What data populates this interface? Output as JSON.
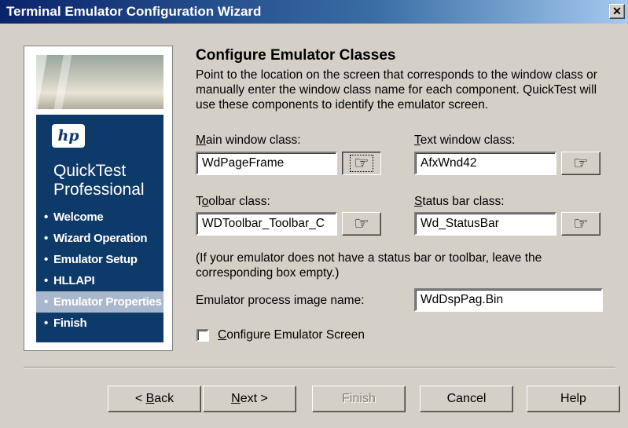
{
  "window": {
    "title": "Terminal Emulator Configuration Wizard",
    "close_glyph": "✕"
  },
  "sidebar": {
    "logo_text": "hp",
    "product_line1": "QuickTest",
    "product_line2": "Professional",
    "steps": [
      {
        "label": "Welcome"
      },
      {
        "label": "Wizard Operation"
      },
      {
        "label": "Emulator Setup"
      },
      {
        "label": "HLLAPI"
      },
      {
        "label": "Emulator Properties",
        "active": true
      },
      {
        "label": "Finish"
      }
    ]
  },
  "page": {
    "heading": "Configure Emulator Classes",
    "description": "Point to the location on the screen that corresponds to the window class or manually enter the window class name for each component. QuickTest will use these components to identify the emulator screen."
  },
  "fields": {
    "main_window": {
      "label_pre": "",
      "label_u": "M",
      "label_post": "ain window class:",
      "value": "WdPageFrame"
    },
    "text_window": {
      "label_pre": "",
      "label_u": "T",
      "label_post": "ext window class:",
      "value": "AfxWnd42"
    },
    "toolbar": {
      "label_pre": "T",
      "label_u": "o",
      "label_post": "olbar class:",
      "value": "WDToolbar_Toolbar_C"
    },
    "status_bar": {
      "label_pre": "",
      "label_u": "S",
      "label_post": "tatus bar class:",
      "value": "Wd_StatusBar"
    },
    "process_image": {
      "label": "Emulator process image name:",
      "value": "WdDspPag.Bin"
    }
  },
  "note": "(If your emulator does not have a status bar or toolbar, leave the corresponding box empty.)",
  "checkbox": {
    "label_u": "C",
    "label_post": "onfigure Emulator Screen"
  },
  "pointer_glyph": "☞",
  "buttons": {
    "back": {
      "pre": "< ",
      "u": "B",
      "post": "ack"
    },
    "next": {
      "u": "N",
      "post": "ext >"
    },
    "finish": "Finish",
    "cancel": "Cancel",
    "help": "Help"
  }
}
